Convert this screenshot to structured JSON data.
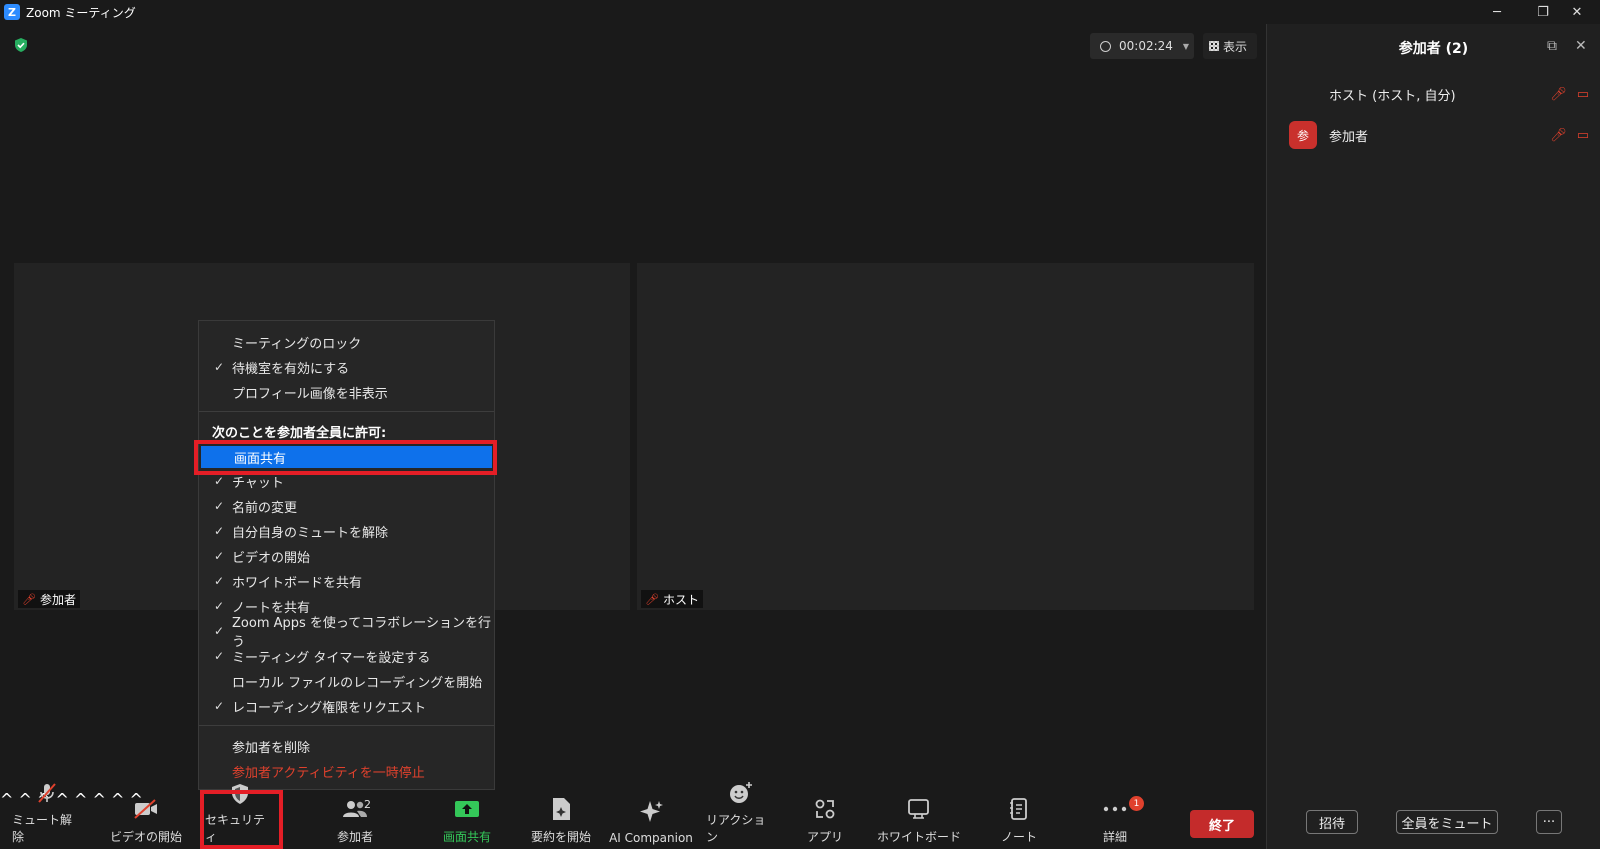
{
  "window": {
    "title": "Zoom ミーティング",
    "minimize": "─",
    "restore": "❐",
    "close": "✕"
  },
  "topbar": {
    "timer": "00:02:24",
    "view_label": "表示"
  },
  "tiles": [
    {
      "name": "参加者"
    },
    {
      "name": "ホスト"
    }
  ],
  "security_menu": {
    "items_top": [
      {
        "label": "ミーティングのロック",
        "checked": ""
      },
      {
        "label": "待機室を有効にする",
        "checked": "✓"
      },
      {
        "label": "プロフィール画像を非表示",
        "checked": ""
      }
    ],
    "allow_header": "次のことを参加者全員に許可:",
    "allow_items": [
      {
        "label": "画面共有",
        "checked": ""
      },
      {
        "label": "チャット",
        "checked": "✓"
      },
      {
        "label": "名前の変更",
        "checked": "✓"
      },
      {
        "label": "自分自身のミュートを解除",
        "checked": "✓"
      },
      {
        "label": "ビデオの開始",
        "checked": "✓"
      },
      {
        "label": "ホワイトボードを共有",
        "checked": "✓"
      },
      {
        "label": "ノートを共有",
        "checked": "✓"
      },
      {
        "label": "Zoom Apps を使ってコラボレーションを行う",
        "checked": "✓"
      },
      {
        "label": "ミーティング タイマーを設定する",
        "checked": "✓"
      },
      {
        "label": "ローカル ファイルのレコーディングを開始",
        "checked": ""
      },
      {
        "label": "レコーディング権限をリクエスト",
        "checked": "✓"
      }
    ],
    "remove_participant": "参加者を削除",
    "suspend_activity": "参加者アクティビティを一時停止"
  },
  "toolbar": {
    "unmute": "ミュート解除",
    "start_video": "ビデオの開始",
    "security": "セキュリティ",
    "participants": "参加者",
    "participants_count": "2",
    "share": "画面共有",
    "summary": "要約を開始",
    "ai": "AI Companion",
    "reactions": "リアクション",
    "apps": "アプリ",
    "whiteboard": "ホワイトボード",
    "notes": "ノート",
    "more": "詳細",
    "more_badge": "1",
    "end": "終了"
  },
  "panel": {
    "title": "参加者 (2)",
    "participants": [
      {
        "name": "ホスト (ホスト, 自分)",
        "avatar": ""
      },
      {
        "name": "参加者",
        "avatar": "参"
      }
    ],
    "invite": "招待",
    "mute_all": "全員をミュート",
    "more": "···"
  },
  "colors": {
    "accent": "#0e71eb",
    "danger": "#e0412d",
    "share_green": "#34c759",
    "highlight_box": "#e41e26"
  }
}
